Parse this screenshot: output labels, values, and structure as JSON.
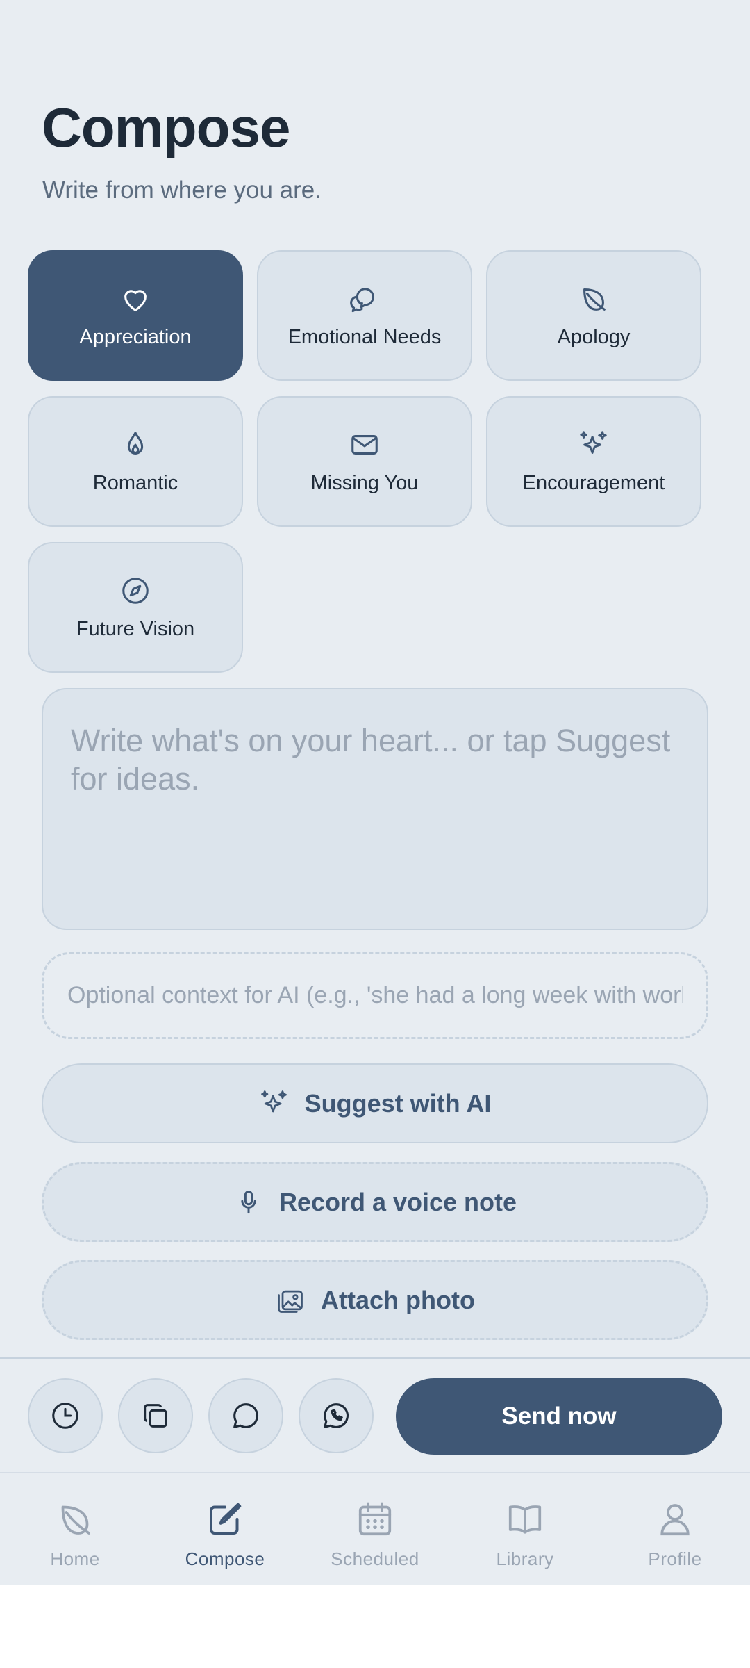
{
  "header": {
    "title": "Compose",
    "subtitle": "Write from where you are."
  },
  "categories": [
    {
      "label": "Appreciation",
      "icon": "heart-icon",
      "selected": true
    },
    {
      "label": "Emotional Needs",
      "icon": "chat-bubbles-icon",
      "selected": false
    },
    {
      "label": "Apology",
      "icon": "leaf-icon",
      "selected": false
    },
    {
      "label": "Romantic",
      "icon": "flame-icon",
      "selected": false
    },
    {
      "label": "Missing You",
      "icon": "envelope-icon",
      "selected": false
    },
    {
      "label": "Encouragement",
      "icon": "sparkles-icon",
      "selected": false
    },
    {
      "label": "Future Vision",
      "icon": "compass-icon",
      "selected": false
    }
  ],
  "composer": {
    "message_placeholder": "Write what's on your heart... or tap Suggest for ideas.",
    "context_placeholder": "Optional context for AI (e.g., 'she had a long week with work')"
  },
  "actions": {
    "suggest_label": "Suggest with AI",
    "voice_label": "Record a voice note",
    "photo_label": "Attach photo"
  },
  "action_bar": {
    "icons": [
      "clock-icon",
      "copy-icon",
      "message-icon",
      "whatsapp-icon"
    ],
    "send_label": "Send now"
  },
  "tabs": [
    {
      "label": "Home",
      "icon": "leaf-icon"
    },
    {
      "label": "Compose",
      "icon": "edit-icon",
      "active": true
    },
    {
      "label": "Scheduled",
      "icon": "calendar-icon"
    },
    {
      "label": "Library",
      "icon": "book-icon"
    },
    {
      "label": "Profile",
      "icon": "person-icon"
    }
  ],
  "colors": {
    "background": "#e8edf2",
    "card": "#dce4ec",
    "accent": "#3f5775",
    "muted": "#9aa5b3",
    "text": "#1e2a38"
  }
}
